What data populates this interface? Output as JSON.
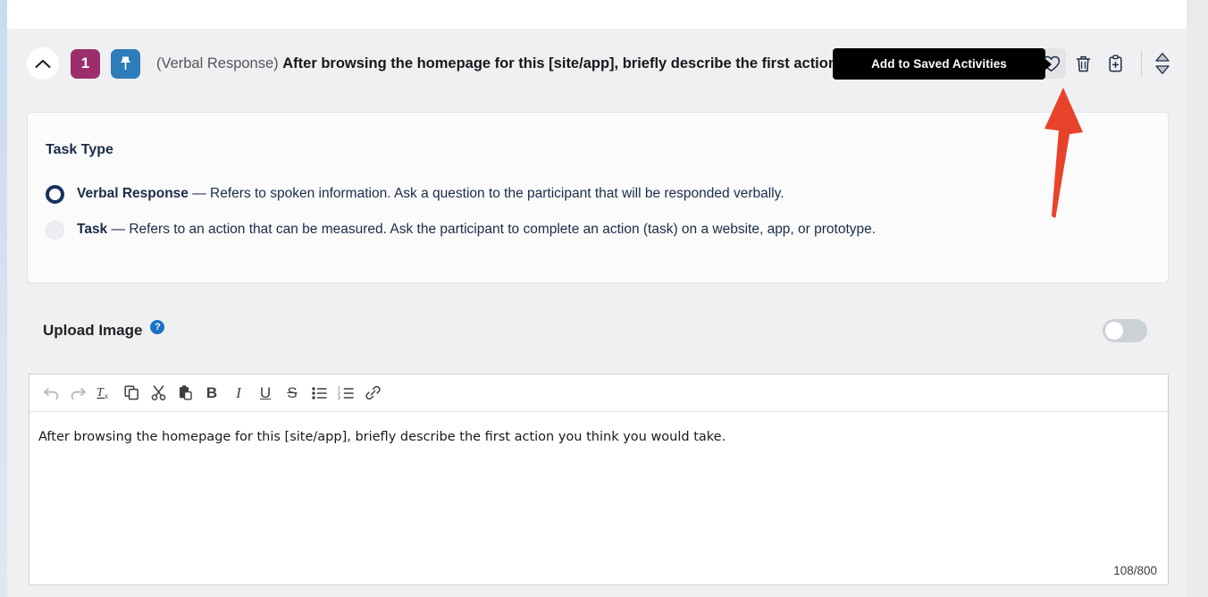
{
  "header": {
    "collapse_icon": "chevron-up-icon",
    "number_badge": "1",
    "pin_icon": "pin-icon",
    "title_prefix": "(Verbal Response) ",
    "title_main": "After browsing the homepage for this [site/app], briefly describe the first action you think you would take.",
    "actions": [
      {
        "name": "favorite",
        "icon": "heart-icon",
        "active": true
      },
      {
        "name": "delete",
        "icon": "trash-icon",
        "active": false
      },
      {
        "name": "duplicate",
        "icon": "clipboard-plus-icon",
        "active": false
      }
    ],
    "reorder_icon": "sort-up-down-icon"
  },
  "tooltip": {
    "text": "Add to Saved Activities"
  },
  "task_type": {
    "heading": "Task Type",
    "options": [
      {
        "selected": true,
        "label": "Verbal Response",
        "dash": " — ",
        "description": "Refers to spoken information. Ask a question to the participant that will be responded verbally."
      },
      {
        "selected": false,
        "label": "Task",
        "dash": " — ",
        "description": "Refers to an action that can be measured. Ask the participant to complete an action (task) on a website, app, or prototype."
      }
    ]
  },
  "upload_image": {
    "label": "Upload Image",
    "help_icon": "help-circle-icon",
    "help_glyph": "?",
    "toggle_on": false
  },
  "editor": {
    "toolbar": [
      {
        "name": "undo-button",
        "icon": "undo-icon",
        "disabled": true
      },
      {
        "name": "redo-button",
        "icon": "redo-icon",
        "disabled": true
      },
      {
        "name": "remove-format-button",
        "icon": "remove-format-icon",
        "disabled": false
      },
      {
        "name": "copy-button",
        "icon": "copy-icon",
        "disabled": false
      },
      {
        "name": "cut-button",
        "icon": "scissors-icon",
        "disabled": false
      },
      {
        "name": "paste-button",
        "icon": "clipboard-icon",
        "disabled": false
      },
      {
        "name": "bold-button",
        "icon": "bold-icon",
        "disabled": false
      },
      {
        "name": "italic-button",
        "icon": "italic-icon",
        "disabled": false
      },
      {
        "name": "underline-button",
        "icon": "underline-icon",
        "disabled": false
      },
      {
        "name": "strikethrough-button",
        "icon": "strikethrough-icon",
        "disabled": false
      },
      {
        "name": "bullet-list-button",
        "icon": "bullet-list-icon",
        "disabled": false
      },
      {
        "name": "numbered-list-button",
        "icon": "numbered-list-icon",
        "disabled": false
      },
      {
        "name": "link-button",
        "icon": "link-icon",
        "disabled": false
      }
    ],
    "content": "After browsing the homepage for this [site/app], briefly describe the first action you think you would take.",
    "char_counter": "108/800"
  },
  "annotation": {
    "type": "arrow",
    "color": "#e8432a",
    "points_to": "favorite-heart-button"
  }
}
